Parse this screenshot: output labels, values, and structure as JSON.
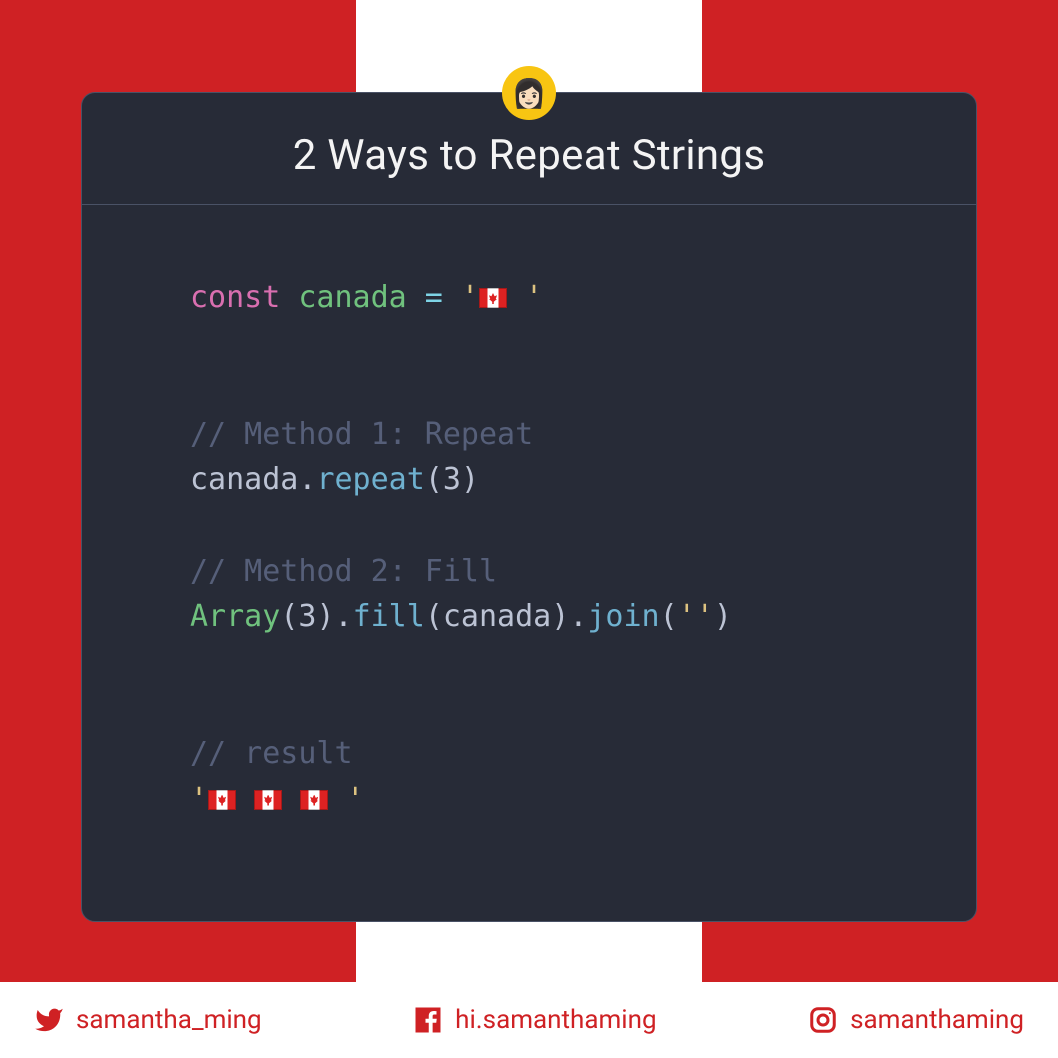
{
  "header": {
    "title": "2 Ways to Repeat Strings",
    "avatar_emoji": "👩🏻"
  },
  "code": {
    "kw_const": "const",
    "var_canada": "canada",
    "eq": " = ",
    "q": "'",
    "space_q": " '",
    "cmt_method1": "// Method 1: Repeat",
    "dot": ".",
    "fn_repeat": "repeat",
    "open_paren": "(",
    "close_paren": ")",
    "num3": "3",
    "cmt_method2": "// Method 2: Fill",
    "cls_array": "Array",
    "fn_fill": "fill",
    "fn_join": "join",
    "empty_str": "''",
    "cmt_result": "// result",
    "result_open": "'",
    "result_gap": " ",
    "result_close": " '"
  },
  "footer": {
    "twitter": "samantha_ming",
    "facebook": "hi.samanthaming",
    "instagram": "samanthaming"
  }
}
